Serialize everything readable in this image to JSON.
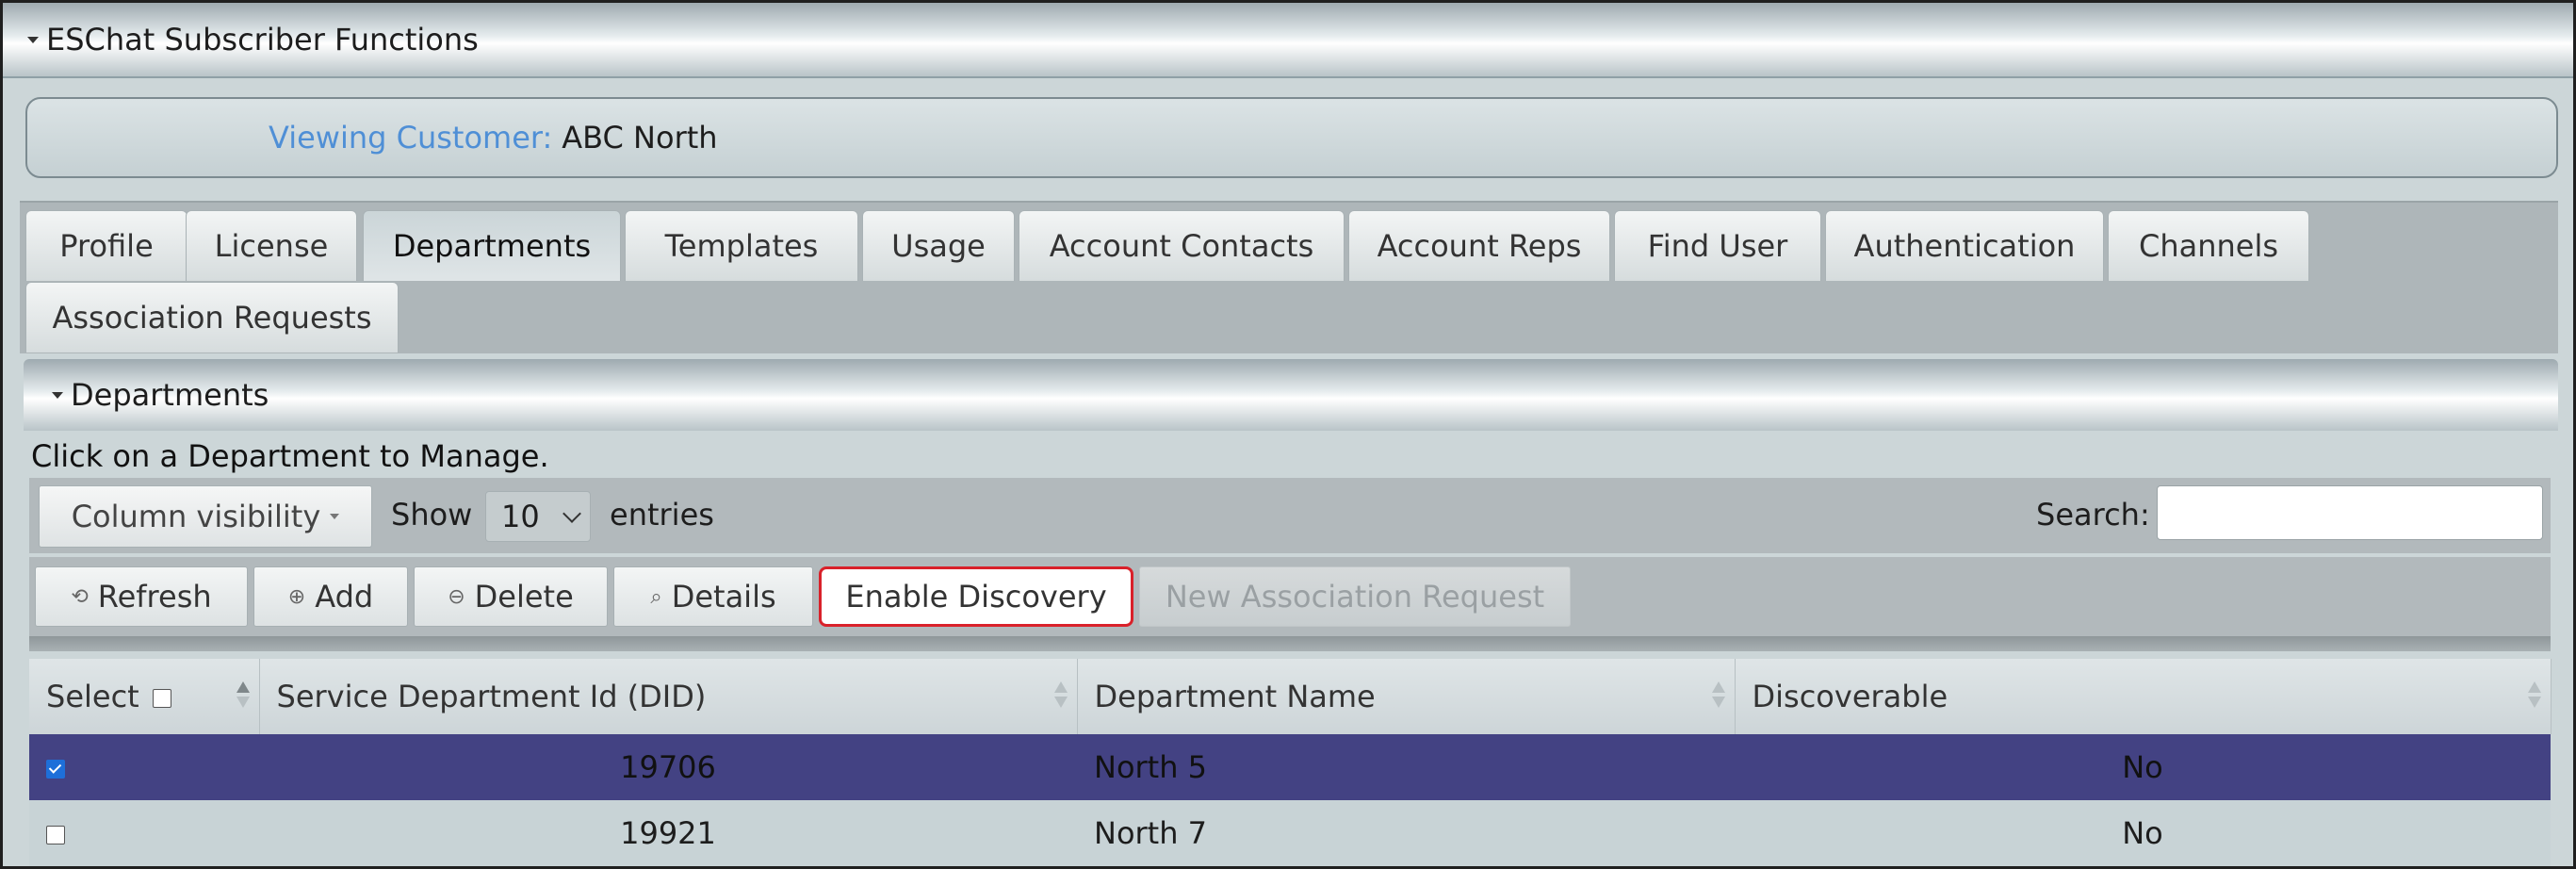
{
  "header": {
    "title": "ESChat Subscriber Functions"
  },
  "customer": {
    "label": "Viewing Customer:",
    "value": "ABC North"
  },
  "tabs": [
    {
      "label": "Profile"
    },
    {
      "label": "License"
    },
    {
      "label": "Departments",
      "active": true
    },
    {
      "label": "Templates"
    },
    {
      "label": "Usage"
    },
    {
      "label": "Account Contacts"
    },
    {
      "label": "Account Reps"
    },
    {
      "label": "Find User"
    },
    {
      "label": "Authentication"
    },
    {
      "label": "Channels"
    },
    {
      "label": "Association Requests"
    }
  ],
  "departments": {
    "title": "Departments",
    "hint": "Click on a Department to Manage."
  },
  "controls": {
    "column_visibility": "Column visibility",
    "show": "Show",
    "entries_value": "10",
    "entries": "entries",
    "search_label": "Search:",
    "search_value": ""
  },
  "toolbar": {
    "refresh": "Refresh",
    "add": "Add",
    "delete": "Delete",
    "details": "Details",
    "enable_discovery": "Enable Discovery",
    "new_association_request": "New Association Request"
  },
  "table": {
    "columns": [
      "Select",
      "Service Department Id (DID)",
      "Department Name",
      "Discoverable"
    ],
    "rows": [
      {
        "did": "19706",
        "name": "North 5",
        "discoverable": "No",
        "selected": true
      },
      {
        "did": "19921",
        "name": "North 7",
        "discoverable": "No",
        "selected": false
      }
    ]
  },
  "colors": {
    "selected_row": "#434283",
    "link_label": "#4f8fd6",
    "highlight_border": "#d9212a"
  }
}
